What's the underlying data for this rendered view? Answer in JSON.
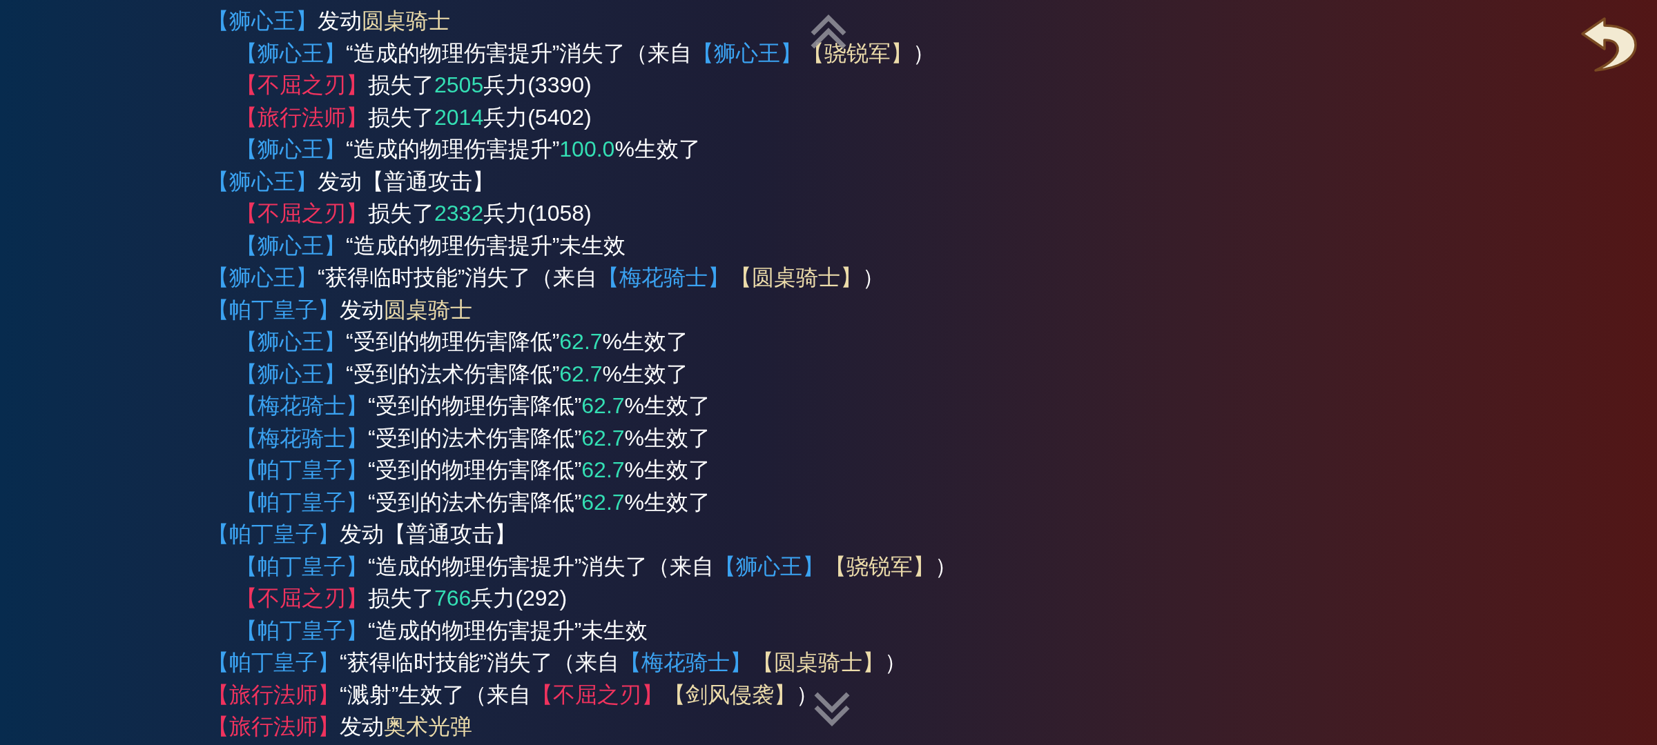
{
  "log": [
    {
      "segments": [
        {
          "kind": "ally",
          "text": "【狮心王】"
        },
        {
          "kind": "text",
          "text": "发动"
        },
        {
          "kind": "skill",
          "text": "圆桌骑士"
        }
      ],
      "children": [
        {
          "segments": [
            {
              "kind": "ally",
              "text": "【狮心王】"
            },
            {
              "kind": "text",
              "text": "“造成的物理伤害提升”消失了（来自"
            },
            {
              "kind": "ally",
              "text": "【狮心王】"
            },
            {
              "kind": "skill",
              "text": "【骁锐军】"
            },
            {
              "kind": "text",
              "text": "）"
            }
          ]
        },
        {
          "segments": [
            {
              "kind": "enemy",
              "text": "【不屈之刃】"
            },
            {
              "kind": "text",
              "text": "损失了"
            },
            {
              "kind": "value",
              "text": "2505"
            },
            {
              "kind": "text",
              "text": "兵力(3390)"
            }
          ]
        },
        {
          "segments": [
            {
              "kind": "enemy",
              "text": "【旅行法师】"
            },
            {
              "kind": "text",
              "text": "损失了"
            },
            {
              "kind": "value",
              "text": "2014"
            },
            {
              "kind": "text",
              "text": "兵力(5402)"
            }
          ]
        },
        {
          "segments": [
            {
              "kind": "ally",
              "text": "【狮心王】"
            },
            {
              "kind": "text",
              "text": "“造成的物理伤害提升”"
            },
            {
              "kind": "value",
              "text": "100.0"
            },
            {
              "kind": "text",
              "text": "%生效了"
            }
          ]
        }
      ]
    },
    {
      "segments": [
        {
          "kind": "ally",
          "text": "【狮心王】"
        },
        {
          "kind": "text",
          "text": "发动【普通攻击】"
        }
      ],
      "children": [
        {
          "segments": [
            {
              "kind": "enemy",
              "text": "【不屈之刃】"
            },
            {
              "kind": "text",
              "text": "损失了"
            },
            {
              "kind": "value",
              "text": "2332"
            },
            {
              "kind": "text",
              "text": "兵力(1058)"
            }
          ]
        },
        {
          "segments": [
            {
              "kind": "ally",
              "text": "【狮心王】"
            },
            {
              "kind": "text",
              "text": "“造成的物理伤害提升”未生效"
            }
          ]
        }
      ]
    },
    {
      "segments": [
        {
          "kind": "ally",
          "text": "【狮心王】"
        },
        {
          "kind": "text",
          "text": "“获得临时技能”消失了（来自"
        },
        {
          "kind": "ally",
          "text": "【梅花骑士】"
        },
        {
          "kind": "skill",
          "text": "【圆桌骑士】"
        },
        {
          "kind": "text",
          "text": "）"
        }
      ]
    },
    {
      "segments": [
        {
          "kind": "ally",
          "text": "【帕丁皇子】"
        },
        {
          "kind": "text",
          "text": "发动"
        },
        {
          "kind": "skill",
          "text": "圆桌骑士"
        }
      ],
      "children": [
        {
          "segments": [
            {
              "kind": "ally",
              "text": "【狮心王】"
            },
            {
              "kind": "text",
              "text": "“受到的物理伤害降低”"
            },
            {
              "kind": "value",
              "text": "62.7"
            },
            {
              "kind": "text",
              "text": "%生效了"
            }
          ]
        },
        {
          "segments": [
            {
              "kind": "ally",
              "text": "【狮心王】"
            },
            {
              "kind": "text",
              "text": "“受到的法术伤害降低”"
            },
            {
              "kind": "value",
              "text": "62.7"
            },
            {
              "kind": "text",
              "text": "%生效了"
            }
          ]
        },
        {
          "segments": [
            {
              "kind": "ally",
              "text": "【梅花骑士】"
            },
            {
              "kind": "text",
              "text": "“受到的物理伤害降低”"
            },
            {
              "kind": "value",
              "text": "62.7"
            },
            {
              "kind": "text",
              "text": "%生效了"
            }
          ]
        },
        {
          "segments": [
            {
              "kind": "ally",
              "text": "【梅花骑士】"
            },
            {
              "kind": "text",
              "text": "“受到的法术伤害降低”"
            },
            {
              "kind": "value",
              "text": "62.7"
            },
            {
              "kind": "text",
              "text": "%生效了"
            }
          ]
        },
        {
          "segments": [
            {
              "kind": "ally",
              "text": "【帕丁皇子】"
            },
            {
              "kind": "text",
              "text": "“受到的物理伤害降低”"
            },
            {
              "kind": "value",
              "text": "62.7"
            },
            {
              "kind": "text",
              "text": "%生效了"
            }
          ]
        },
        {
          "segments": [
            {
              "kind": "ally",
              "text": "【帕丁皇子】"
            },
            {
              "kind": "text",
              "text": "“受到的法术伤害降低”"
            },
            {
              "kind": "value",
              "text": "62.7"
            },
            {
              "kind": "text",
              "text": "%生效了"
            }
          ]
        }
      ]
    },
    {
      "segments": [
        {
          "kind": "ally",
          "text": "【帕丁皇子】"
        },
        {
          "kind": "text",
          "text": "发动【普通攻击】"
        }
      ],
      "children": [
        {
          "segments": [
            {
              "kind": "ally",
              "text": "【帕丁皇子】"
            },
            {
              "kind": "text",
              "text": "“造成的物理伤害提升”消失了（来自"
            },
            {
              "kind": "ally",
              "text": "【狮心王】"
            },
            {
              "kind": "skill",
              "text": "【骁锐军】"
            },
            {
              "kind": "text",
              "text": "）"
            }
          ]
        },
        {
          "segments": [
            {
              "kind": "enemy",
              "text": "【不屈之刃】"
            },
            {
              "kind": "text",
              "text": "损失了"
            },
            {
              "kind": "value",
              "text": "766"
            },
            {
              "kind": "text",
              "text": "兵力(292)"
            }
          ]
        },
        {
          "segments": [
            {
              "kind": "ally",
              "text": "【帕丁皇子】"
            },
            {
              "kind": "text",
              "text": "“造成的物理伤害提升”未生效"
            }
          ]
        }
      ]
    },
    {
      "segments": [
        {
          "kind": "ally",
          "text": "【帕丁皇子】"
        },
        {
          "kind": "text",
          "text": "“获得临时技能”消失了（来自"
        },
        {
          "kind": "ally",
          "text": "【梅花骑士】"
        },
        {
          "kind": "skill",
          "text": "【圆桌骑士】"
        },
        {
          "kind": "text",
          "text": "）"
        }
      ]
    },
    {
      "segments": [
        {
          "kind": "enemy",
          "text": "【旅行法师】"
        },
        {
          "kind": "text",
          "text": "“溅射”生效了（来自"
        },
        {
          "kind": "enemy",
          "text": "【不屈之刃】"
        },
        {
          "kind": "skill",
          "text": "【剑风侵袭】"
        },
        {
          "kind": "text",
          "text": "）"
        }
      ]
    },
    {
      "segments": [
        {
          "kind": "enemy",
          "text": "【旅行法师】"
        },
        {
          "kind": "text",
          "text": "发动"
        },
        {
          "kind": "skill",
          "text": "奥术光弹"
        }
      ]
    }
  ]
}
